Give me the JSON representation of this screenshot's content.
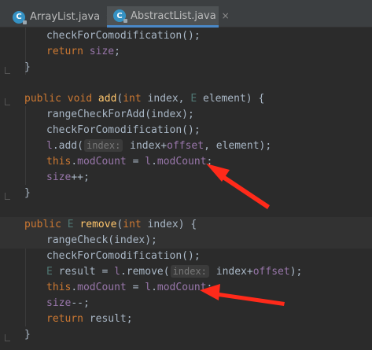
{
  "tabs": [
    {
      "label": "ArrayList.java",
      "close": "×",
      "icon": "java-class-icon"
    },
    {
      "label": "AbstractList.java",
      "close": "×",
      "icon": "java-class-icon",
      "active": true
    }
  ],
  "code": {
    "l1": "checkForComodification();",
    "l2_kw": "return",
    "l2_fd": "size",
    "l2_end": ";",
    "l3": "}",
    "l5_kw1": "public void",
    "l5_fn": "add",
    "l5_p1": "(",
    "l5_kw2": "int",
    "l5_p2": " index, ",
    "l5_ty": "E",
    "l5_p3": " element) {",
    "l6": "rangeCheckForAdd(index);",
    "l7": "checkForComodification();",
    "l8_fd": "l",
    "l8_p1": ".add(",
    "l8_hint": "index:",
    "l8_p2": "index+",
    "l8_fd2": "offset",
    "l8_p3": ", element);",
    "l9_kw": "this",
    "l9_p1": ".",
    "l9_fd1": "modCount",
    "l9_p2": " = ",
    "l9_fd2": "l",
    "l9_p3": ".",
    "l9_fd3": "modCount",
    "l9_p4": ";",
    "l10_fd": "size",
    "l10_p": "++;",
    "l11": "}",
    "l13_kw1": "public",
    "l13_ty": "E",
    "l13_fn": "remove",
    "l13_p1": "(",
    "l13_kw2": "int",
    "l13_p2": " index) {",
    "l14": "rangeCheck(index);",
    "l15": "checkForComodification();",
    "l16_ty": "E",
    "l16_p1": " result = ",
    "l16_fd": "l",
    "l16_p2": ".remove(",
    "l16_hint": "index:",
    "l16_p3": "index+",
    "l16_fd2": "offset",
    "l16_p4": ");",
    "l17_kw": "this",
    "l17_p1": ".",
    "l17_fd1": "modCount",
    "l17_p2": " = ",
    "l17_fd2": "l",
    "l17_p3": ".",
    "l17_fd3": "modCount",
    "l17_p4": ";",
    "l18_fd": "size",
    "l18_p": "--;",
    "l19_kw": "return",
    "l19_p": " result;",
    "l20": "}"
  },
  "colors": {
    "background": "#2b2b2b",
    "keyword": "#cc7832",
    "method": "#ffc66d",
    "field": "#9876aa",
    "annotation_arrow": "#ff2a1a"
  }
}
